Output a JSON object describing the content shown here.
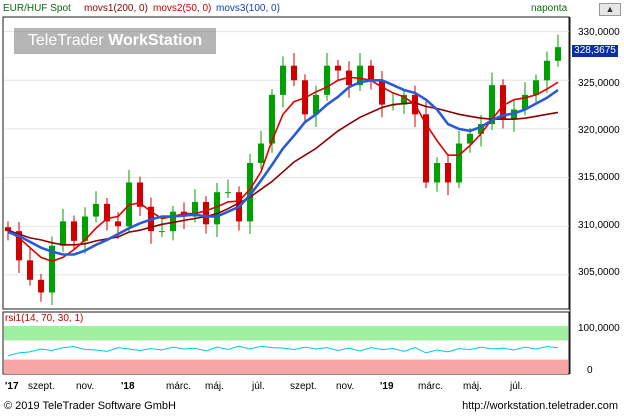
{
  "header": {
    "instrument": "EUR/HUF Spot",
    "indicator1": "movs1(200, 0)",
    "indicator2": "movs2(50, 0)",
    "indicator3": "movs3(100, 0)",
    "period": "naponta"
  },
  "watermark": {
    "brand": "TeleTrader",
    "product": "WorkStation"
  },
  "last_price": "328,3675",
  "rsi_label": "rsi1(14, 70, 30, 1)",
  "footer": {
    "copyright": "© 2019 TeleTrader Software GmbH",
    "url": "http://workstation.teletrader.com"
  },
  "colors": {
    "candle_up": "#00a000",
    "candle_down": "#d00000",
    "movs_200": "#8b0000",
    "movs_50": "#e00000",
    "movs_100": "#2a5bd7",
    "rsi_line": "#00c8e0",
    "rsi_overbought_zone": "#9ff09f",
    "rsi_oversold_zone": "#f7a5a5",
    "price_badge": "#0a2ea8"
  },
  "chart_data": [
    {
      "type": "candlestick",
      "yticks": [
        "330,0000",
        "325,0000",
        "320,0000",
        "315,0000",
        "310,0000",
        "305,0000"
      ],
      "ylim": [
        301.5,
        331.5
      ],
      "xticks": [
        "'17",
        "szept.",
        "nov.",
        "'18",
        "márc.",
        "máj.",
        "júl.",
        "szept.",
        "nov.",
        "'19",
        "márc.",
        "máj.",
        "júl."
      ],
      "series": [
        {
          "name": "EUR/HUF Spot",
          "values": [
            309.5,
            306.5,
            304.5,
            303.2,
            308.0,
            310.5,
            308.5,
            311.0,
            312.3,
            310.5,
            310.0,
            314.5,
            312.0,
            309.5,
            309.5,
            311.5,
            311.0,
            312.5,
            310.2,
            313.5,
            313.5,
            310.5,
            316.5,
            318.5,
            323.5,
            326.5,
            325.0,
            321.5,
            323.5,
            326.5,
            326.0,
            324.5,
            326.5,
            325.0,
            322.5,
            322.5,
            323.5,
            321.5,
            314.5,
            316.5,
            314.5,
            318.5,
            319.5,
            320.5,
            324.5,
            321.0,
            322.0,
            323.5,
            325.0,
            327.0,
            328.4
          ]
        },
        {
          "name": "movs1(200, 0)",
          "values": [
            309.6,
            309.2,
            308.8,
            308.6,
            308.3,
            308.1,
            308.1,
            308.2,
            308.5,
            308.7,
            308.9,
            309.4,
            309.6,
            309.9,
            310.2,
            310.4,
            310.6,
            310.8,
            311.0,
            311.3,
            311.8,
            312.4,
            313.0,
            313.8,
            314.6,
            315.6,
            316.6,
            317.3,
            318.0,
            318.9,
            319.8,
            320.5,
            321.2,
            321.7,
            322.2,
            322.5,
            322.6,
            322.7,
            322.3,
            322.1,
            321.8,
            321.5,
            321.3,
            321.1,
            321.0,
            321.0,
            321.0,
            321.1,
            321.3,
            321.5,
            321.7
          ]
        },
        {
          "name": "movs2(50, 0)",
          "values": [
            309.5,
            308.8,
            307.8,
            306.8,
            306.4,
            306.8,
            307.6,
            308.6,
            309.8,
            310.8,
            311.0,
            312.2,
            312.4,
            311.5,
            310.8,
            311.0,
            311.3,
            311.3,
            311.6,
            312.0,
            312.5,
            312.6,
            313.8,
            315.6,
            318.8,
            321.5,
            322.8,
            323.2,
            323.8,
            324.3,
            325.0,
            325.3,
            325.2,
            325.0,
            324.3,
            323.7,
            323.3,
            322.5,
            320.5,
            318.8,
            317.3,
            317.3,
            318.3,
            319.5,
            321.0,
            322.4,
            323.0,
            323.2,
            323.5,
            324.1,
            324.8
          ]
        },
        {
          "name": "movs3(100, 0)",
          "values": [
            309.4,
            309.0,
            308.4,
            307.8,
            307.4,
            307.1,
            307.1,
            307.5,
            308.1,
            308.6,
            309.2,
            309.8,
            310.3,
            310.7,
            311.0,
            311.0,
            311.1,
            311.2,
            311.0,
            311.0,
            311.5,
            312.0,
            313.2,
            314.7,
            316.3,
            318.0,
            319.3,
            320.7,
            321.5,
            322.5,
            323.3,
            324.3,
            324.8,
            325.0,
            325.0,
            324.5,
            324.0,
            323.7,
            323.0,
            322.0,
            320.5,
            320.0,
            319.8,
            320.2,
            320.9,
            321.4,
            321.6,
            322.0,
            322.6,
            323.2,
            324.0
          ]
        }
      ]
    },
    {
      "type": "line",
      "yticks": [
        "100,0000",
        "0"
      ],
      "ylim": [
        0,
        100
      ],
      "overbought": 70,
      "oversold": 30,
      "series": [
        {
          "name": "rsi1(14, 70, 30, 1)",
          "values": [
            38,
            44,
            46,
            52,
            49,
            55,
            57,
            51,
            50,
            47,
            55,
            52,
            49,
            53,
            50,
            56,
            52,
            54,
            48,
            56,
            51,
            58,
            52,
            58,
            55,
            54,
            51,
            56,
            52,
            55,
            49,
            54,
            48,
            55,
            51,
            53,
            47,
            55,
            44,
            50,
            46,
            53,
            51,
            56,
            52,
            54,
            50,
            56,
            52,
            57,
            55
          ]
        }
      ]
    }
  ]
}
